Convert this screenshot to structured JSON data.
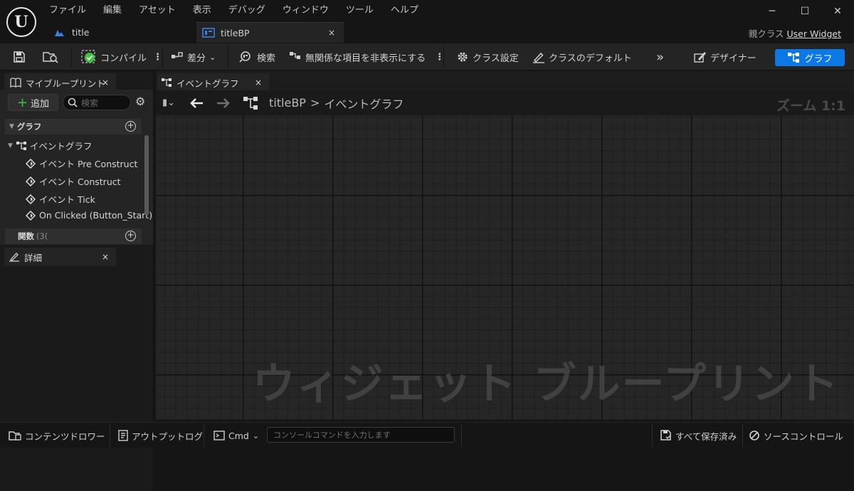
{
  "app": {
    "logo": "U"
  },
  "menu": [
    "ファイル",
    "編集",
    "アセット",
    "表示",
    "デバッグ",
    "ウィンドウ",
    "ツール",
    "ヘルプ"
  ],
  "window_controls": {
    "minimize": "─",
    "maximize": "☐",
    "close": "✕"
  },
  "doc_tabs": [
    {
      "label": "title",
      "icon": "widget-asset-icon"
    },
    {
      "label": "titleBP",
      "icon": "blueprint-graph-icon",
      "close": "×"
    }
  ],
  "parent_class": {
    "prefix": "親クラス",
    "value": "User Widget"
  },
  "toolbar": {
    "compile": "コンパイル",
    "diff": "差分",
    "search": "検索",
    "hide_unrelated": "無関係な項目を非表示にする",
    "class_settings": "クラス設定",
    "class_defaults": "クラスのデフォルト",
    "more": "»",
    "designer": "デザイナー",
    "graph": "グラフ"
  },
  "my_blueprint": {
    "tab_label": "マイブループリント",
    "close": "×",
    "add_label": "追加",
    "search_placeholder": "検索",
    "graphs_header": "グラフ",
    "event_graph": "イベントグラフ",
    "events": [
      "イベント Pre Construct",
      "イベント Construct",
      "イベント Tick",
      "On Clicked (Button_Start)"
    ],
    "functions_header": "関数",
    "functions_count": "(3("
  },
  "details": {
    "tab_label": "詳細",
    "close": "×"
  },
  "graph_panel": {
    "tab_label": "イベントグラフ",
    "close": "×",
    "breadcrumb_root": "titleBP",
    "breadcrumb_sep": ">",
    "breadcrumb_current": "イベントグラフ",
    "zoom": "ズーム 1:1",
    "watermark": "ウィジェット ブループリント"
  },
  "status_bar": {
    "content_drawer": "コンテンツドロワー",
    "output_log": "アウトプットログ",
    "cmd": "Cmd",
    "cmd_placeholder": "コンソールコマンドを入力します",
    "save_all": "すべて保存済み",
    "source_control": "ソースコントロール"
  },
  "colors": {
    "accent": "#0b78e6",
    "add_plus": "#3fc23f",
    "compile_ok": "#3fc23f"
  }
}
